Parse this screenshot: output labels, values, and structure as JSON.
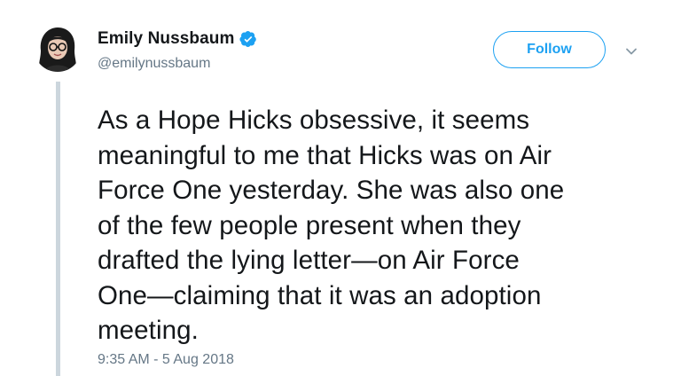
{
  "tweet": {
    "author": {
      "display_name": "Emily Nussbaum",
      "handle": "@emilynussbaum",
      "verified": true,
      "avatar_icon": "avatar-illustration-icon"
    },
    "follow_label": "Follow",
    "caret_icon": "chevron-down-icon",
    "text": "As a Hope Hicks obsessive, it seems\nmeaningful to me that Hicks was on Air\nForce One yesterday. She was also one\nof the few people present when they\ndrafted the lying letter—on Air Force\nOne—claiming that it was an adoption\nmeeting.",
    "timestamp": "9:35 AM - 5 Aug 2018"
  },
  "colors": {
    "brand_blue": "#1da1f2",
    "text_primary": "#14171a",
    "text_secondary": "#657786",
    "thread_line": "#ccd6dd"
  }
}
